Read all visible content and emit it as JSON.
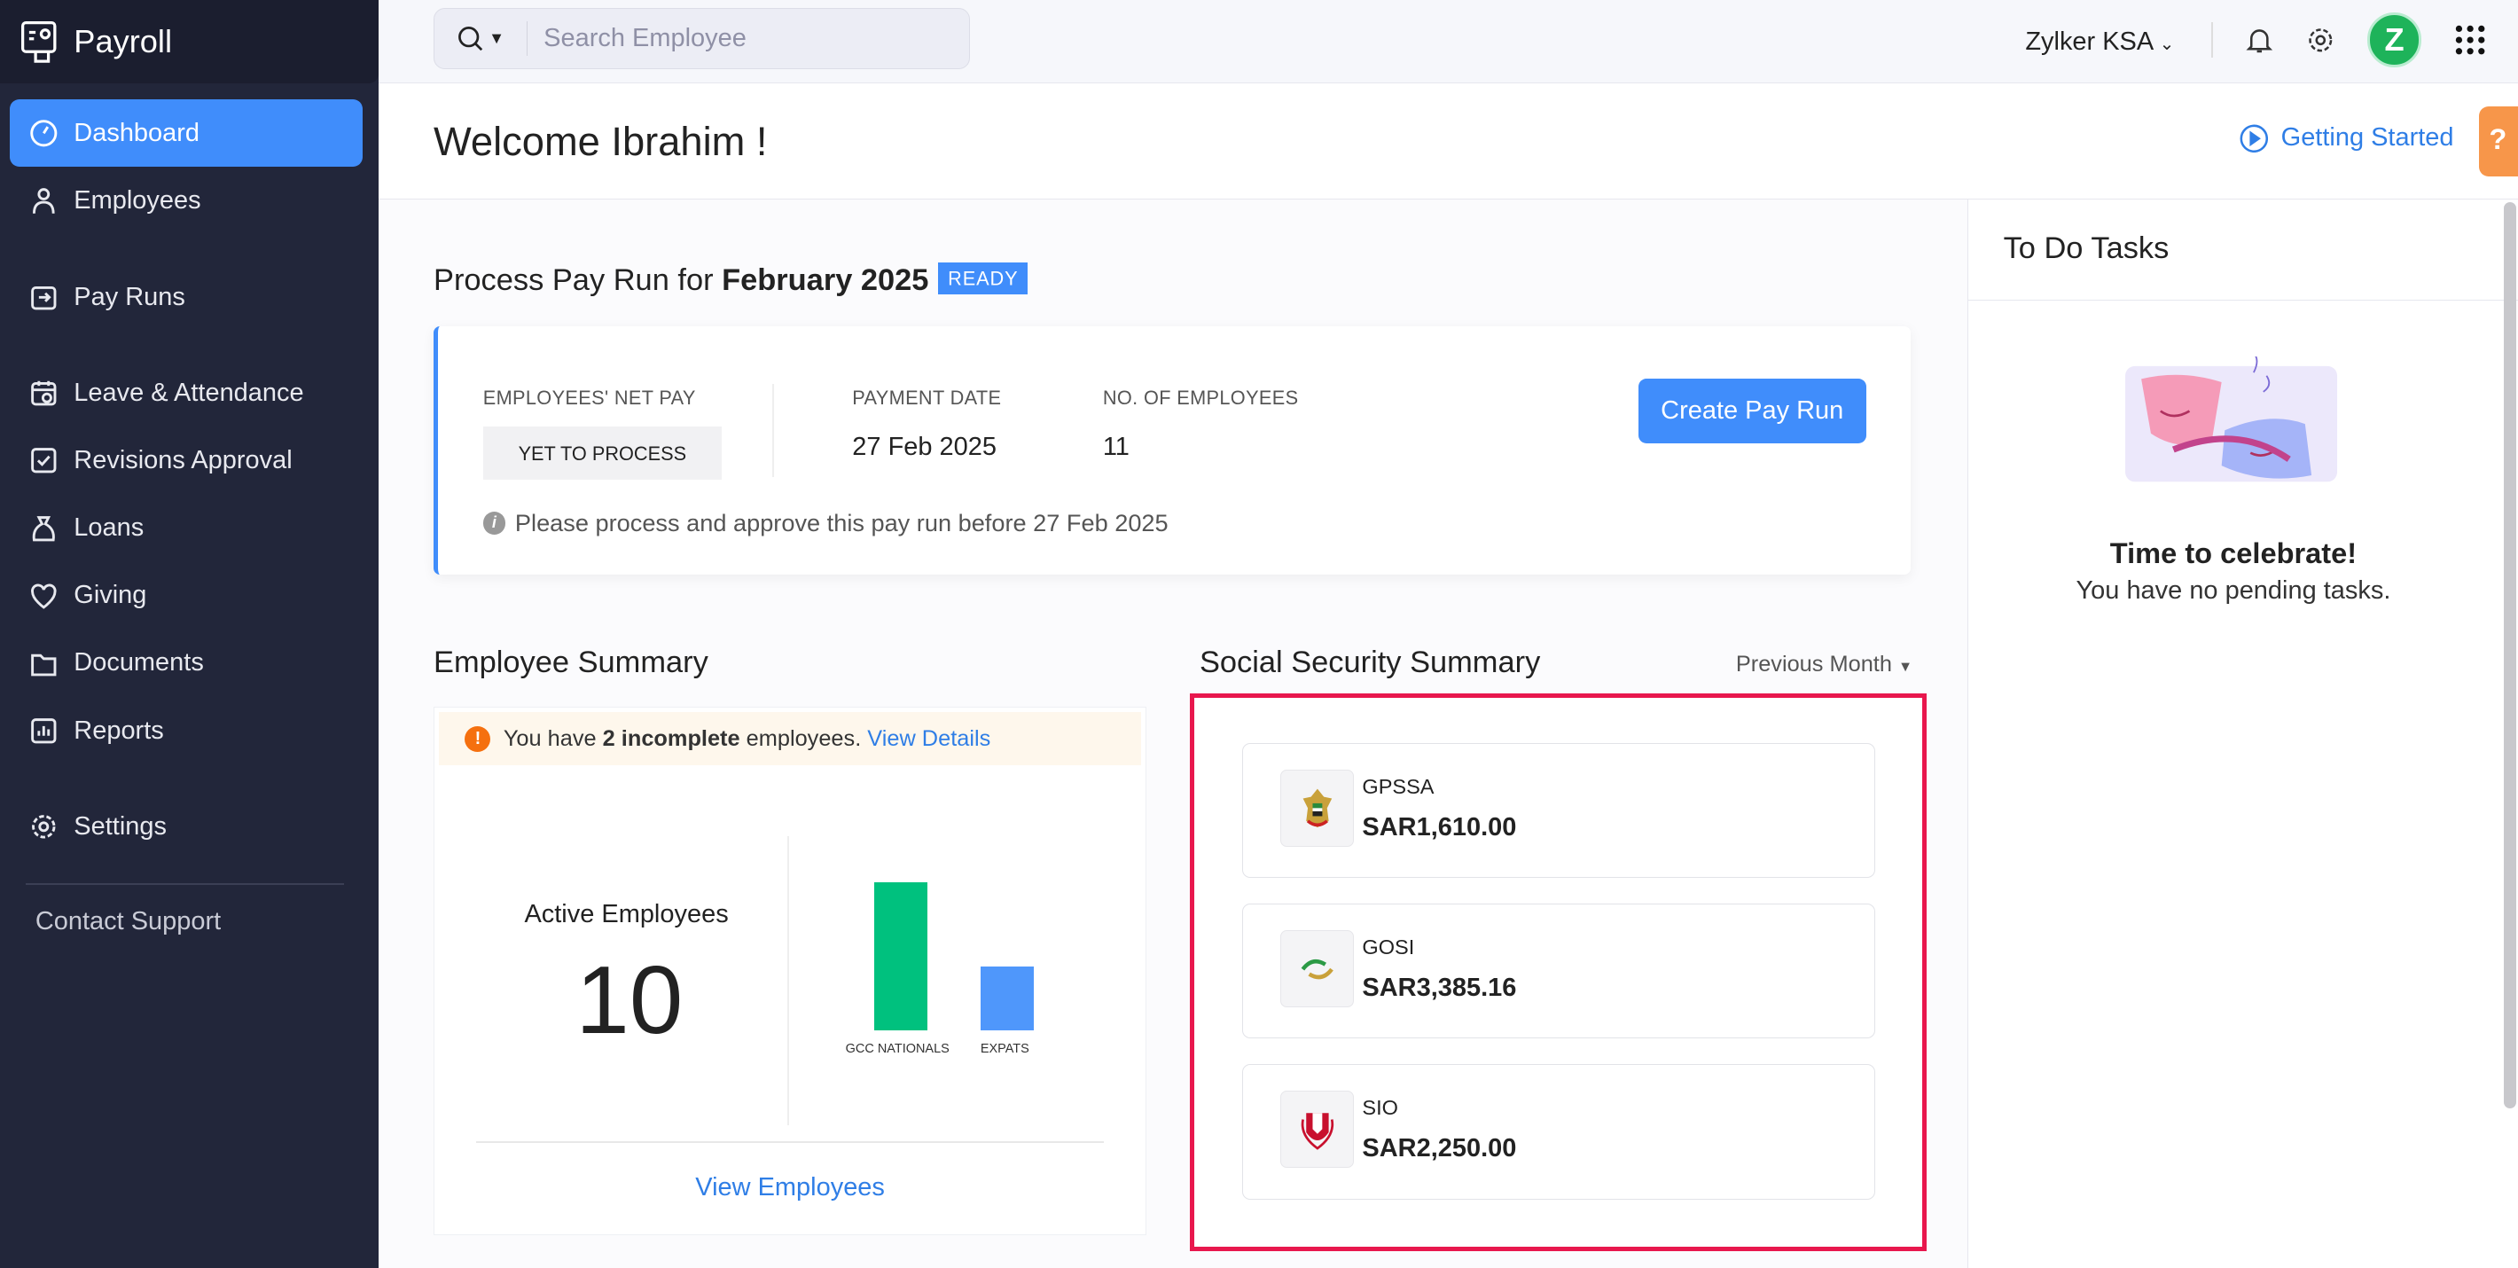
{
  "app": {
    "title": "Payroll"
  },
  "sidebar": {
    "items": [
      {
        "label": "Dashboard",
        "icon": "gauge-icon"
      },
      {
        "label": "Employees",
        "icon": "person-icon"
      },
      {
        "label": "Pay Runs",
        "icon": "payrun-icon"
      },
      {
        "label": "Leave & Attendance",
        "icon": "calendar-icon"
      },
      {
        "label": "Revisions Approval",
        "icon": "check-square-icon"
      },
      {
        "label": "Loans",
        "icon": "money-bag-icon"
      },
      {
        "label": "Giving",
        "icon": "heart-icon"
      },
      {
        "label": "Documents",
        "icon": "folder-icon"
      },
      {
        "label": "Reports",
        "icon": "chart-icon"
      },
      {
        "label": "Settings",
        "icon": "gear-icon"
      }
    ],
    "contact_support": "Contact Support"
  },
  "topbar": {
    "search_placeholder": "Search Employee",
    "org": "Zylker KSA",
    "avatar": "Z"
  },
  "header": {
    "welcome": "Welcome Ibrahim !",
    "getting_started": "Getting Started",
    "help": "?"
  },
  "payrun": {
    "title_prefix": "Process Pay Run for",
    "period": "February 2025",
    "status": "READY",
    "net_pay_label": "EMPLOYEES' NET PAY",
    "net_pay_value": "YET TO PROCESS",
    "payment_date_label": "PAYMENT DATE",
    "payment_date": "27 Feb 2025",
    "employees_label": "NO. OF EMPLOYEES",
    "employees": "11",
    "create_button": "Create Pay Run",
    "note": "Please process and approve this pay run before 27 Feb 2025"
  },
  "employee_summary": {
    "title": "Employee Summary",
    "warning_pre": "You have",
    "warning_bold": "2 incomplete",
    "warning_post": "employees.",
    "view_details": "View Details",
    "active_label": "Active Employees",
    "active_count": "10",
    "bars": [
      {
        "label": "GCC NATIONALS",
        "value": 7,
        "color": "#00c17e"
      },
      {
        "label": "EXPATS",
        "value": 3,
        "color": "#4f97fb"
      }
    ],
    "view_employees": "View Employees"
  },
  "social_security": {
    "title": "Social Security Summary",
    "filter": "Previous Month",
    "items": [
      {
        "name": "GPSSA",
        "amount": "SAR1,610.00"
      },
      {
        "name": "GOSI",
        "amount": "SAR3,385.16"
      },
      {
        "name": "SIO",
        "amount": "SAR2,250.00"
      }
    ]
  },
  "todo": {
    "title": "To Do Tasks",
    "heading": "Time to celebrate!",
    "message": "You have no pending tasks."
  }
}
